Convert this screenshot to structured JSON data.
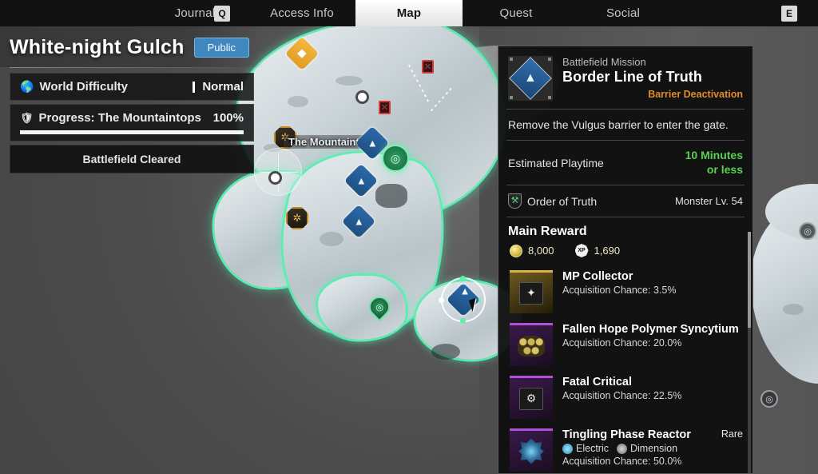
{
  "tabbar": {
    "key_left": "Q",
    "key_right": "E",
    "tabs": [
      {
        "label": "Journal",
        "active": false
      },
      {
        "label": "Access Info",
        "active": false
      },
      {
        "label": "Map",
        "active": true
      },
      {
        "label": "Quest",
        "active": false
      },
      {
        "label": "Social",
        "active": false
      }
    ]
  },
  "zone": {
    "title": "White-night Gulch",
    "access_badge": "Public",
    "difficulty_label": "World Difficulty",
    "difficulty_value": "Normal",
    "progress_label": "Progress: The Mountaintops",
    "progress_value": "100%",
    "progress_percent": 100,
    "status": "Battlefield Cleared"
  },
  "map": {
    "region_label": "The Mountaintops",
    "markers": [
      {
        "name": "objective-marker-gold",
        "type": "diamond-gold"
      },
      {
        "name": "mission-marker-blue",
        "type": "diamond-blue"
      },
      {
        "name": "resource-marker",
        "type": "octagon"
      },
      {
        "name": "stronghold-marker",
        "type": "green-circle"
      },
      {
        "name": "waypoint-marker",
        "type": "white-dot"
      },
      {
        "name": "gate-marker",
        "type": "red-gate"
      }
    ]
  },
  "mission": {
    "kicker": "Battlefield Mission",
    "title": "Border Line of Truth",
    "objective_type": "Barrier Deactivation",
    "description": "Remove the Vulgus barrier to enter the gate.",
    "playtime_label": "Estimated Playtime",
    "playtime_value_line1": "10 Minutes",
    "playtime_value_line2": "or less",
    "faction": "Order of Truth",
    "monster_level": "Monster Lv. 54",
    "reward_header": "Main Reward",
    "gold": "8,000",
    "xp": "1,690",
    "xp_icon_label": "XP",
    "rewards": [
      {
        "name": "MP Collector",
        "chance": "Acquisition Chance: 3.5%",
        "thumb": "gold",
        "glyph": "✦",
        "tags": [],
        "rarity": ""
      },
      {
        "name": "Fallen Hope Polymer Syncytium",
        "chance": "Acquisition Chance: 20.0%",
        "thumb": "purple",
        "glyph": "honeycomb",
        "tags": [],
        "rarity": ""
      },
      {
        "name": "Fatal Critical",
        "chance": "Acquisition Chance: 22.5%",
        "thumb": "purple",
        "glyph": "⚙",
        "tags": [],
        "rarity": ""
      },
      {
        "name": "Tingling Phase Reactor",
        "chance": "Acquisition Chance: 50.0%",
        "thumb": "purple",
        "glyph": "reactor",
        "tags": [
          "Electric",
          "Dimension"
        ],
        "rarity": "Rare"
      }
    ]
  },
  "colors": {
    "accent_blue": "#3f88bf",
    "objective_orange": "#e08c2a",
    "success_green": "#5ad14e",
    "boundary_green": "#55f0b0",
    "rarity_purple": "#b14fd8"
  }
}
